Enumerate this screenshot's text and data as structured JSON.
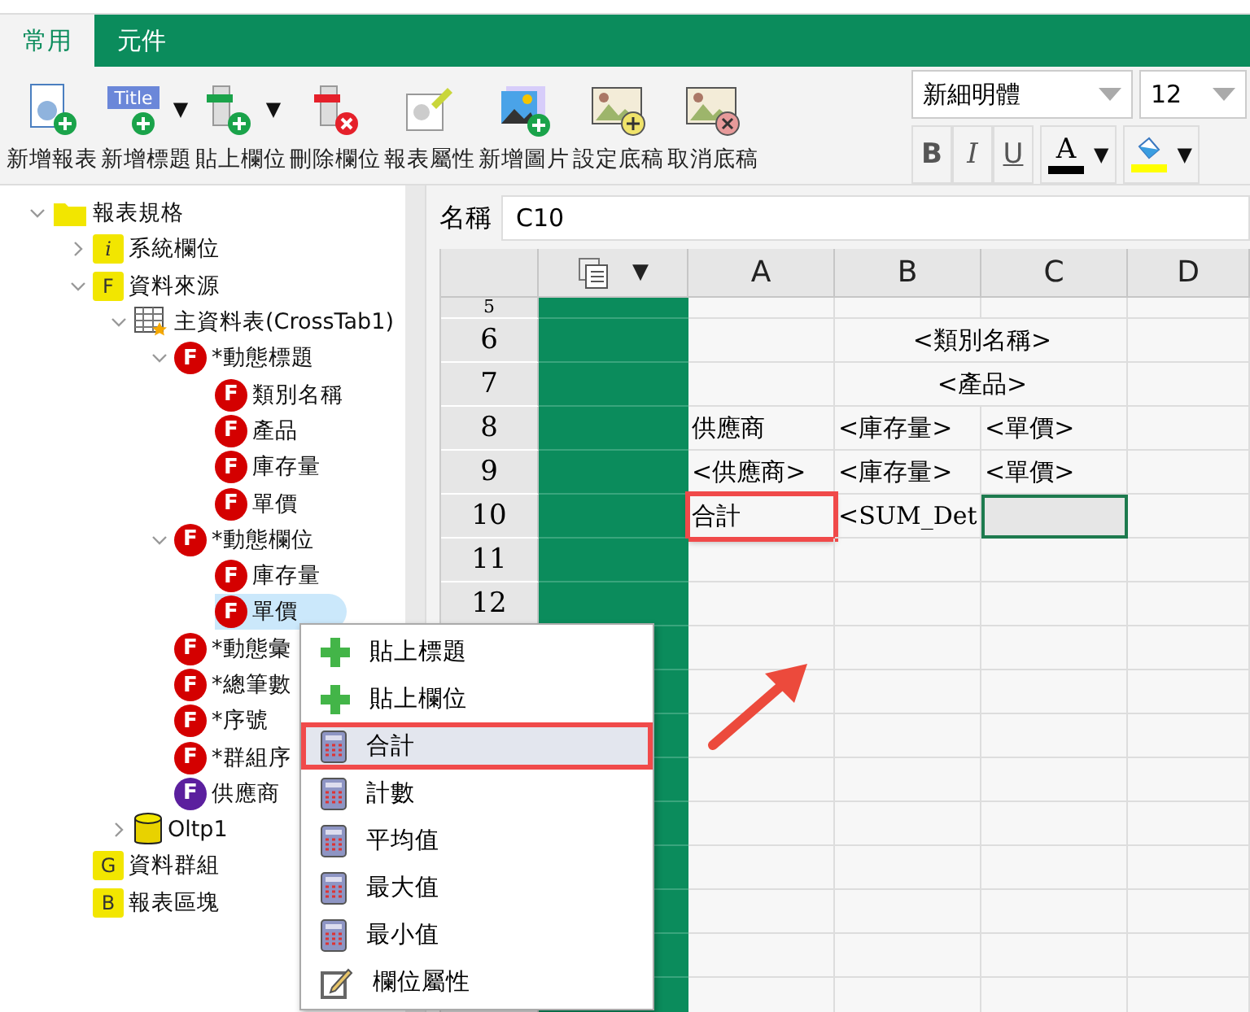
{
  "tabs": [
    {
      "label": "常用",
      "selected": true
    },
    {
      "label": "元件",
      "selected": false
    }
  ],
  "toolbar": {
    "buttons": [
      {
        "kind": "new-report",
        "label": "新增報表"
      },
      {
        "kind": "new-title",
        "label": "新增標題",
        "icon_text": "Title",
        "caret": "▼"
      },
      {
        "kind": "paste-field",
        "label": "貼上欄位",
        "caret": "▼"
      },
      {
        "kind": "delete-field",
        "label": "刪除欄位"
      },
      {
        "kind": "report-props",
        "label": "報表屬性"
      },
      {
        "kind": "new-image",
        "label": "新增圖片"
      },
      {
        "kind": "set-bg",
        "label": "設定底稿"
      },
      {
        "kind": "clear-bg",
        "label": "取消底稿"
      }
    ],
    "font": "新細明體",
    "size": "12",
    "styles": [
      {
        "kind": "bold",
        "label": "B"
      },
      {
        "kind": "italic",
        "label": "I"
      },
      {
        "kind": "underline",
        "label": "U"
      }
    ],
    "font_color": {
      "letter": "A",
      "color": "#000000",
      "caret": "▼"
    },
    "fill_color": {
      "color": "#ffff00",
      "caret": "▼"
    }
  },
  "tree": [
    {
      "label": "報表規格",
      "kind": "folder",
      "expanded": true,
      "selected": false,
      "children": [
        {
          "label": "系統欄位",
          "kind": "badge-folder",
          "badge": "i",
          "expanded": false,
          "selected": false
        },
        {
          "label": "資料來源",
          "kind": "badge-folder",
          "badge": "F",
          "expanded": true,
          "selected": false,
          "children": [
            {
              "label": "主資料表(CrossTab1)",
              "kind": "table",
              "expanded": true,
              "selected": false,
              "children": [
                {
                  "label": "*動態標題",
                  "kind": "field",
                  "badge": "F",
                  "color": "#d40000",
                  "expanded": true,
                  "selected": false,
                  "children": [
                    {
                      "label": "類別名稱",
                      "kind": "field",
                      "badge": "F",
                      "color": "#d40000",
                      "selected": false
                    },
                    {
                      "label": "產品",
                      "kind": "field",
                      "badge": "F",
                      "color": "#d40000",
                      "selected": false
                    },
                    {
                      "label": "庫存量",
                      "kind": "field",
                      "badge": "F",
                      "color": "#d40000",
                      "selected": false
                    },
                    {
                      "label": "單價",
                      "kind": "field",
                      "badge": "F",
                      "color": "#d40000",
                      "selected": false
                    }
                  ]
                },
                {
                  "label": "*動態欄位",
                  "kind": "field",
                  "badge": "F",
                  "color": "#d40000",
                  "expanded": true,
                  "selected": false,
                  "children": [
                    {
                      "label": "庫存量",
                      "kind": "field",
                      "badge": "F",
                      "color": "#d40000",
                      "selected": false
                    },
                    {
                      "label": "單價",
                      "kind": "field",
                      "badge": "F",
                      "color": "#d40000",
                      "selected": true
                    }
                  ]
                },
                {
                  "label": "*動態彙",
                  "kind": "field",
                  "badge": "F",
                  "color": "#d40000",
                  "selected": false
                },
                {
                  "label": "*總筆數",
                  "kind": "field",
                  "badge": "F",
                  "color": "#d40000",
                  "selected": false
                },
                {
                  "label": "*序號",
                  "kind": "field",
                  "badge": "F",
                  "color": "#d40000",
                  "selected": false
                },
                {
                  "label": "*群組序",
                  "kind": "field",
                  "badge": "F",
                  "color": "#d40000",
                  "selected": false
                },
                {
                  "label": "供應商",
                  "kind": "field",
                  "badge": "F",
                  "color": "#5b1f9e",
                  "selected": false
                }
              ]
            },
            {
              "label": "Oltp1",
              "kind": "database",
              "expanded": false,
              "selected": false
            }
          ]
        },
        {
          "label": "資料群組",
          "kind": "badge-folder",
          "badge": "G",
          "selected": false
        },
        {
          "label": "報表區塊",
          "kind": "badge-folder",
          "badge": "B",
          "selected": false
        }
      ]
    }
  ],
  "name_field": {
    "label": "名稱",
    "value": "C10"
  },
  "sheet": {
    "header_caret": "▼",
    "columns": [
      "A",
      "B",
      "C",
      "D"
    ],
    "rows": [
      {
        "label": "5",
        "cells": []
      },
      {
        "label": "6",
        "cells": [
          {
            "kind": "plain",
            "selected": false
          },
          {
            "kind": "merged",
            "text": "<類別名稱>",
            "selected": false
          },
          {
            "kind": "plain",
            "selected": false
          }
        ]
      },
      {
        "label": "7",
        "cells": [
          {
            "kind": "plain",
            "selected": false
          },
          {
            "kind": "merged",
            "text": "<產品>",
            "selected": false
          },
          {
            "kind": "plain",
            "selected": false
          }
        ]
      },
      {
        "label": "8",
        "cells": [
          {
            "kind": "plain",
            "text": "供應商",
            "selected": false
          },
          {
            "kind": "plain",
            "text": "<庫存量>",
            "selected": false
          },
          {
            "kind": "plain",
            "text": "<單價>",
            "selected": false
          },
          {
            "kind": "plain",
            "selected": false
          }
        ]
      },
      {
        "label": "9",
        "cells": [
          {
            "kind": "plain",
            "text": "<供應商>",
            "selected": false
          },
          {
            "kind": "plain",
            "text": "<庫存量>",
            "selected": false
          },
          {
            "kind": "plain",
            "text": "<單價>",
            "selected": false
          },
          {
            "kind": "plain",
            "selected": false
          }
        ]
      },
      {
        "label": "10",
        "cells": [
          {
            "kind": "plain",
            "text": "合計",
            "selected": false,
            "highlighted": true
          },
          {
            "kind": "plain",
            "text": "<SUM_Det",
            "selected": false,
            "highlighted": false
          },
          {
            "kind": "plain",
            "selected": true,
            "highlighted": false
          },
          {
            "kind": "plain",
            "selected": false,
            "highlighted": false
          }
        ]
      },
      {
        "label": "11",
        "cells": []
      },
      {
        "label": "12",
        "cells": []
      }
    ]
  },
  "context_menu": {
    "items": [
      {
        "kind": "plus",
        "label": "貼上標題",
        "selected": false
      },
      {
        "kind": "plus",
        "label": "貼上欄位",
        "selected": false
      },
      {
        "kind": "calc",
        "label": "合計",
        "selected": true
      },
      {
        "kind": "calc",
        "label": "計數",
        "selected": false
      },
      {
        "kind": "calc",
        "label": "平均值",
        "selected": false
      },
      {
        "kind": "calc",
        "label": "最大值",
        "selected": false
      },
      {
        "kind": "calc",
        "label": "最小值",
        "selected": false
      },
      {
        "kind": "edit",
        "label": "欄位屬性",
        "selected": false
      }
    ]
  }
}
